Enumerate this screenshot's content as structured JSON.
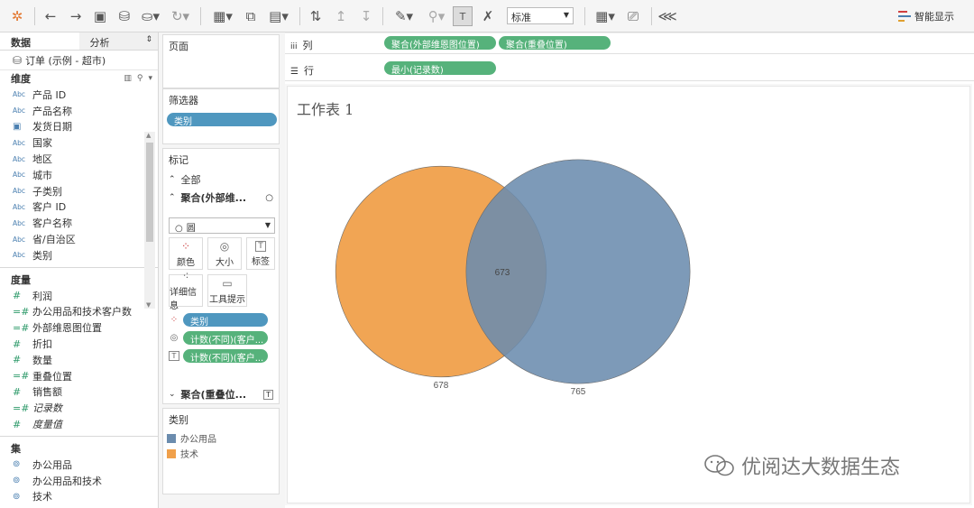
{
  "toolbar": {
    "mark_size_select": "标准",
    "smart_show_label": "智能显示"
  },
  "left_panel": {
    "tabs": [
      "数据",
      "分析"
    ],
    "datasource": "订单 (示例 - 超市)",
    "dimensions_header": "维度",
    "dimensions": [
      {
        "name": "产品 ID",
        "type": "Abc"
      },
      {
        "name": "产品名称",
        "type": "Abc"
      },
      {
        "name": "发货日期",
        "type": "date"
      },
      {
        "name": "国家",
        "type": "Abc"
      },
      {
        "name": "地区",
        "type": "Abc"
      },
      {
        "name": "城市",
        "type": "Abc"
      },
      {
        "name": "子类别",
        "type": "Abc"
      },
      {
        "name": "客户 ID",
        "type": "Abc"
      },
      {
        "name": "客户名称",
        "type": "Abc"
      },
      {
        "name": "省/自治区",
        "type": "Abc"
      },
      {
        "name": "类别",
        "type": "Abc"
      }
    ],
    "measures_header": "度量",
    "measures": [
      {
        "name": "利润",
        "type": "#",
        "italic": false
      },
      {
        "name": "办公用品和技术客户数",
        "type": "=#",
        "italic": false
      },
      {
        "name": "外部维恩图位置",
        "type": "=#",
        "italic": false
      },
      {
        "name": "折扣",
        "type": "#",
        "italic": false
      },
      {
        "name": "数量",
        "type": "#",
        "italic": false
      },
      {
        "name": "重叠位置",
        "type": "=#",
        "italic": false
      },
      {
        "name": "销售额",
        "type": "#",
        "italic": false
      },
      {
        "name": "记录数",
        "type": "=#",
        "italic": true
      },
      {
        "name": "度量值",
        "type": "#",
        "italic": true
      }
    ],
    "sets_header": "集",
    "sets": [
      "办公用品",
      "办公用品和技术",
      "技术"
    ]
  },
  "middle_panel": {
    "pages_label": "页面",
    "filters_label": "筛选器",
    "filter_pill": "类别",
    "marks_label": "标记",
    "all_label": "全部",
    "agg1_label": "聚合(外部维...",
    "mark_type": "圆",
    "buttons": {
      "color": "颜色",
      "size": "大小",
      "label": "标签",
      "detail": "详细信息",
      "tooltip": "工具提示"
    },
    "mark_pills": [
      "类别",
      "计数(不同)(客户...",
      "计数(不同)(客户..."
    ],
    "agg2_label": "聚合(重叠位...",
    "legend_title": "类别",
    "legend": [
      {
        "name": "办公用品",
        "color": "#6b8cae"
      },
      {
        "name": "技术",
        "color": "#f0a04b"
      }
    ]
  },
  "shelves": {
    "columns_label": "列",
    "columns_pills": [
      "聚合(外部维恩图位置)",
      "聚合(重叠位置)"
    ],
    "rows_label": "行",
    "rows_pills": [
      "最小(记录数)"
    ]
  },
  "worksheet_title": "工作表 1",
  "chart_data": {
    "type": "venn",
    "sets": [
      {
        "name": "技术",
        "value": 678,
        "color": "#f0a04b"
      },
      {
        "name": "办公用品",
        "value": 765,
        "color": "#6b8cae"
      }
    ],
    "overlap": 673
  },
  "watermark": "优阅达大数据生态"
}
